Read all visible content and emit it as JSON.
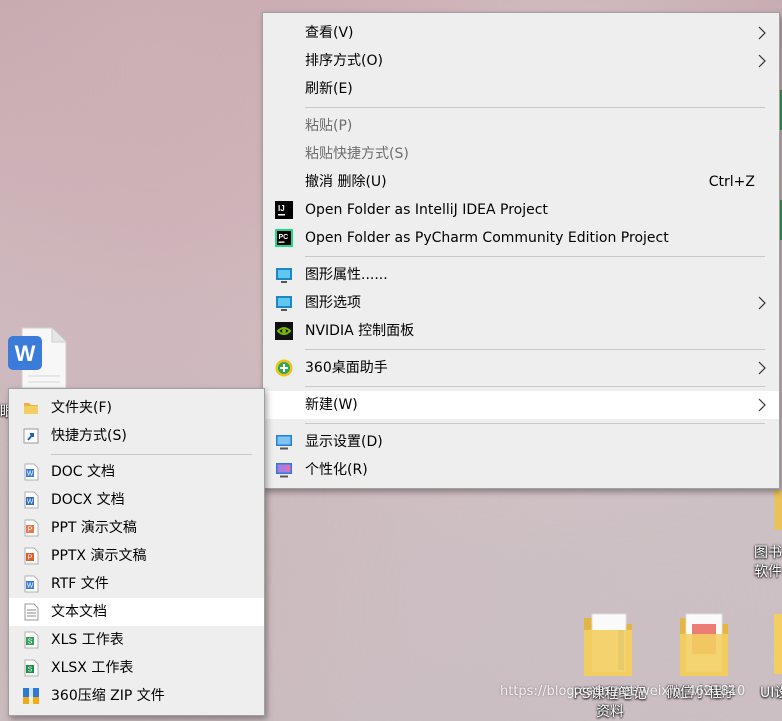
{
  "main_menu": {
    "view": "查看(V)",
    "sort": "排序方式(O)",
    "refresh": "刷新(E)",
    "paste": "粘贴(P)",
    "paste_shortcut": "粘贴快捷方式(S)",
    "undo": "撤消 删除(U)",
    "undo_key": "Ctrl+Z",
    "intellij": "Open Folder as IntelliJ IDEA Project",
    "pycharm": "Open Folder as PyCharm Community Edition Project",
    "graphics_props": "图形属性......",
    "graphics_options": "图形选项",
    "nvidia": "NVIDIA 控制面板",
    "assistant360": "360桌面助手",
    "new": "新建(W)",
    "display": "显示设置(D)",
    "personalize": "个性化(R)"
  },
  "sub_menu": {
    "folder": "文件夹(F)",
    "shortcut": "快捷方式(S)",
    "doc": "DOC 文档",
    "docx": "DOCX 文档",
    "ppt": "PPT 演示文稿",
    "pptx": "PPTX 演示文稿",
    "rtf": "RTF 文件",
    "txt": "文本文档",
    "xls": "XLS 工作表",
    "xlsx": "XLSX 工作表",
    "zip": "360压缩 ZIP 文件"
  },
  "desktop": {
    "ps_notes": "PS课程笔记资料",
    "wechat_mini": "微信小程序",
    "ui_partial": "UI设",
    "books_line1": "图书",
    "books_line2": "软件",
    "left_partial": "眼"
  },
  "watermark": "https://blog.csdn.net/weixin_4621810",
  "colors": {
    "menu_bg": "#eeeeee",
    "highlight": "#ffffff",
    "disabled_text": "#6d6d6d"
  }
}
